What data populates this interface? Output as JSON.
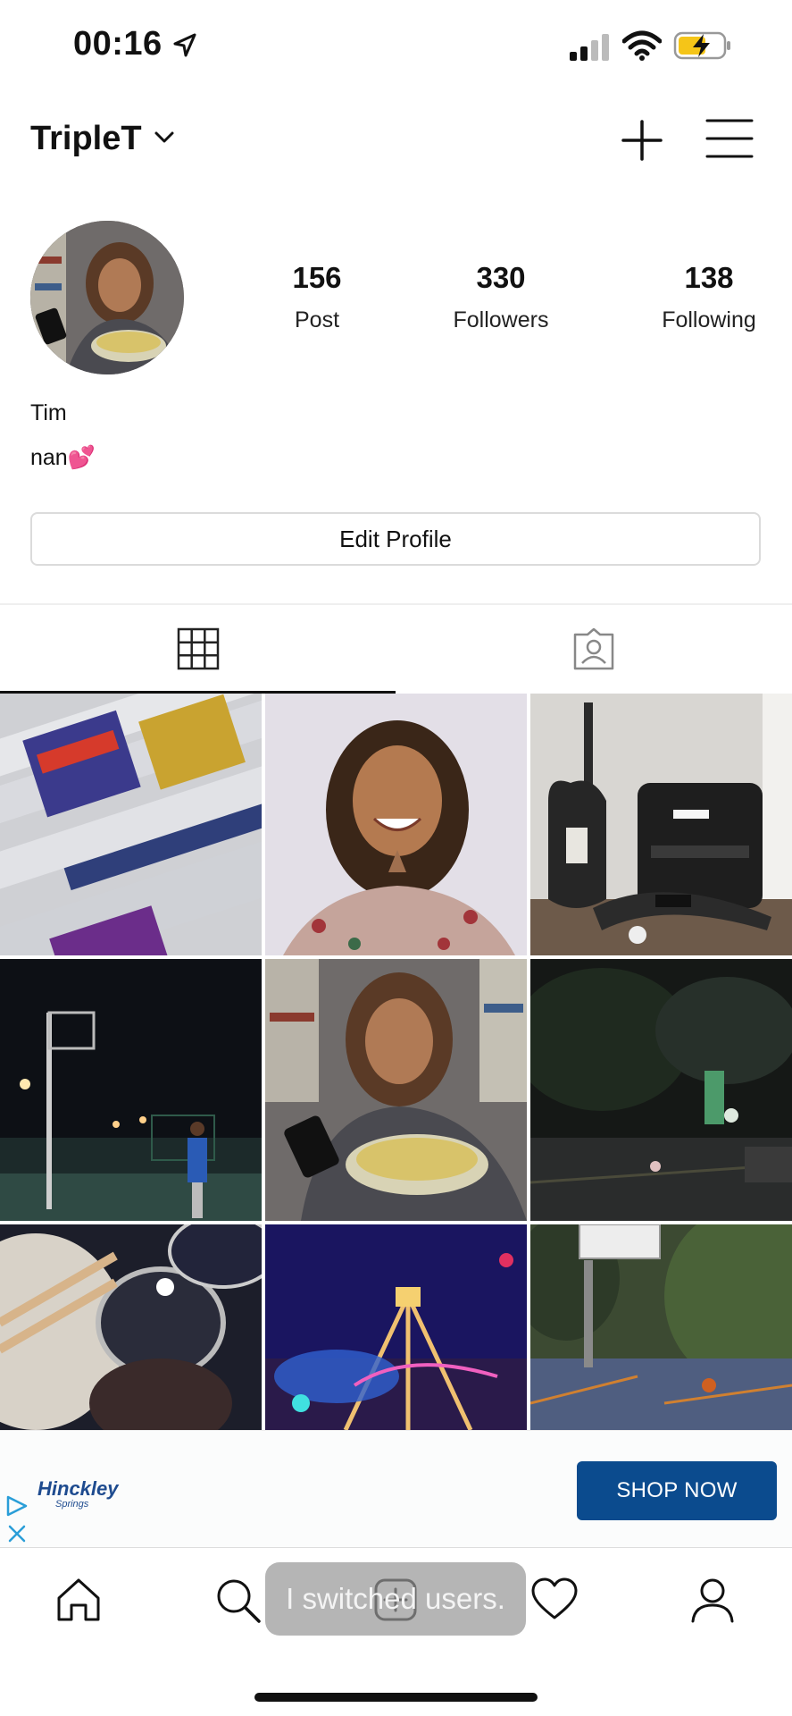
{
  "status_bar": {
    "time": "00:16"
  },
  "header": {
    "username": "TripleT"
  },
  "profile": {
    "stats": [
      {
        "value": "156",
        "label": "Post"
      },
      {
        "value": "330",
        "label": "Followers"
      },
      {
        "value": "138",
        "label": "Following"
      }
    ],
    "name": "Tim",
    "bio": "nan💕",
    "edit_button": "Edit Profile"
  },
  "tabs": {
    "active": "grid"
  },
  "ad": {
    "brand": "Hinckley",
    "brand_sub": "Springs",
    "cta": "SHOP NOW"
  },
  "toast": {
    "text": "I switched users."
  },
  "colors": {
    "accent": "#0b4b8e",
    "battery": "#f5c518"
  }
}
